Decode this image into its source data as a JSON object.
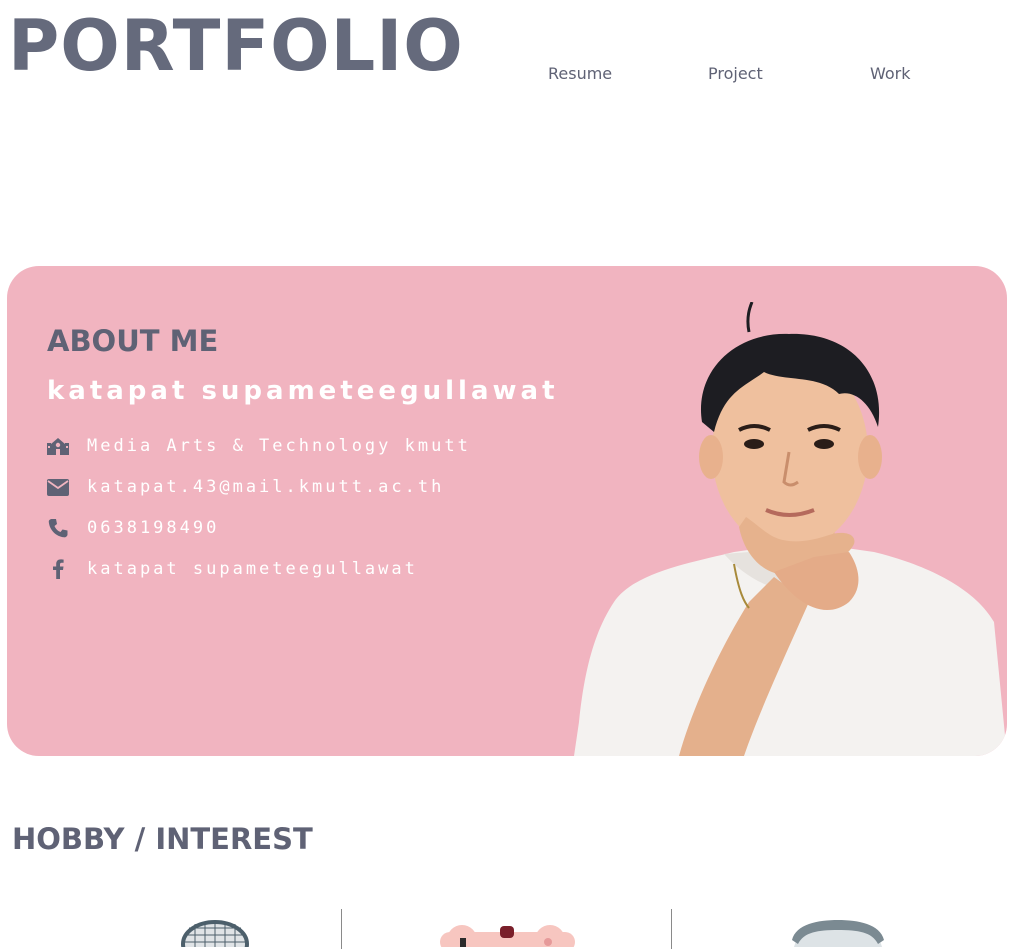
{
  "header": {
    "brand": "PORTFOLIO",
    "nav": [
      {
        "label": "Resume"
      },
      {
        "label": "Project"
      },
      {
        "label": "Work"
      }
    ]
  },
  "about": {
    "title": "ABOUT ME",
    "name": "katapat supameteegullawat",
    "background_color": "#f1b4c0",
    "items": [
      {
        "icon": "school-icon",
        "text": "Media Arts & Technology kmutt"
      },
      {
        "icon": "envelope-icon",
        "text": "katapat.43@mail.kmutt.ac.th"
      },
      {
        "icon": "phone-icon",
        "text": "0638198490"
      },
      {
        "icon": "facebook-icon",
        "text": "katapat supameteegullawat"
      }
    ]
  },
  "hobby": {
    "title": "HOBBY / INTEREST",
    "icons": [
      "badminton-racket-icon",
      "game-controller-icon",
      "helmet-icon"
    ]
  },
  "colors": {
    "heading": "#5f6275",
    "accent_pink": "#f1b4c0",
    "text_light": "#ffffff"
  }
}
